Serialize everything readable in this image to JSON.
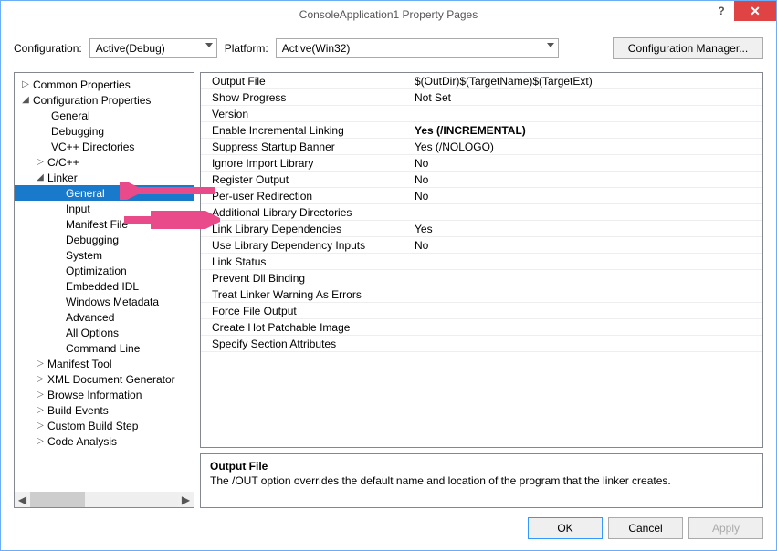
{
  "window": {
    "title": "ConsoleApplication1 Property Pages"
  },
  "config": {
    "label_config": "Configuration:",
    "combo_config": "Active(Debug)",
    "label_platform": "Platform:",
    "combo_platform": "Active(Win32)",
    "btn_cfgmgr": "Configuration Manager..."
  },
  "tree": {
    "common": "Common Properties",
    "cfgprops": "Configuration Properties",
    "general0": "General",
    "debugging0": "Debugging",
    "vcdirs": "VC++ Directories",
    "ccpp": "C/C++",
    "linker": "Linker",
    "lgeneral": "General",
    "linput": "Input",
    "lmanifest": "Manifest File",
    "ldebugging": "Debugging",
    "lsystem": "System",
    "lopt": "Optimization",
    "leidl": "Embedded IDL",
    "lwinmd": "Windows Metadata",
    "ladv": "Advanced",
    "lall": "All Options",
    "lcmd": "Command Line",
    "manifesttool": "Manifest Tool",
    "xmldoc": "XML Document Generator",
    "browseinfo": "Browse Information",
    "buildevents": "Build Events",
    "custombuild": "Custom Build Step",
    "codeanalysis": "Code Analysis"
  },
  "grid": [
    {
      "k": "Output File",
      "v": "$(OutDir)$(TargetName)$(TargetExt)",
      "bold": false
    },
    {
      "k": "Show Progress",
      "v": "Not Set",
      "bold": false
    },
    {
      "k": "Version",
      "v": "",
      "bold": false
    },
    {
      "k": "Enable Incremental Linking",
      "v": "Yes (/INCREMENTAL)",
      "bold": true
    },
    {
      "k": "Suppress Startup Banner",
      "v": "Yes (/NOLOGO)",
      "bold": false
    },
    {
      "k": "Ignore Import Library",
      "v": "No",
      "bold": false
    },
    {
      "k": "Register Output",
      "v": "No",
      "bold": false
    },
    {
      "k": "Per-user Redirection",
      "v": "No",
      "bold": false
    },
    {
      "k": "Additional Library Directories",
      "v": "",
      "bold": false
    },
    {
      "k": "Link Library Dependencies",
      "v": "Yes",
      "bold": false
    },
    {
      "k": "Use Library Dependency Inputs",
      "v": "No",
      "bold": false
    },
    {
      "k": "Link Status",
      "v": "",
      "bold": false
    },
    {
      "k": "Prevent Dll Binding",
      "v": "",
      "bold": false
    },
    {
      "k": "Treat Linker Warning As Errors",
      "v": "",
      "bold": false
    },
    {
      "k": "Force File Output",
      "v": "",
      "bold": false
    },
    {
      "k": "Create Hot Patchable Image",
      "v": "",
      "bold": false
    },
    {
      "k": "Specify Section Attributes",
      "v": "",
      "bold": false
    }
  ],
  "desc": {
    "title": "Output File",
    "body": "The /OUT option overrides the default name and location of the program that the linker creates."
  },
  "buttons": {
    "ok": "OK",
    "cancel": "Cancel",
    "apply": "Apply"
  }
}
